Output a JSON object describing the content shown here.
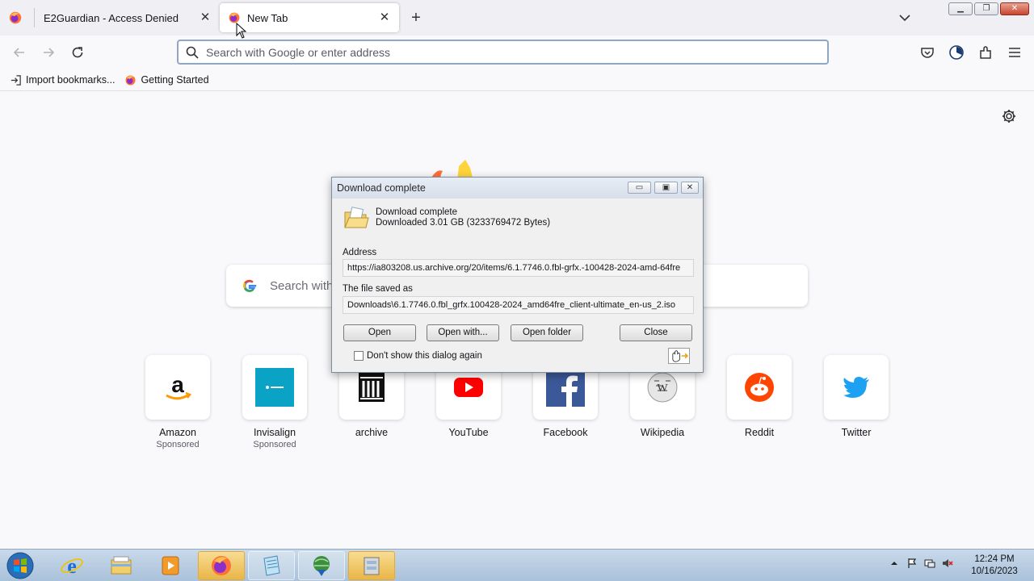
{
  "browser": {
    "tabs": [
      {
        "title": "E2Guardian - Access Denied",
        "active": false
      },
      {
        "title": "New Tab",
        "active": true
      }
    ],
    "tab_close_glyph": "✕",
    "newtab_glyph": "+",
    "window_controls": {
      "minimize": "▁",
      "restore": "❐",
      "close": "✕"
    },
    "urlbar": {
      "placeholder": "Search with Google or enter address",
      "value": ""
    },
    "bookmarks": [
      {
        "label": "Import bookmarks...",
        "icon": "import-icon"
      },
      {
        "label": "Getting Started",
        "icon": "firefox-icon"
      }
    ]
  },
  "newtab": {
    "search_placeholder": "Search with Google or enter address",
    "search_visible_text": "Search with",
    "top_sites": [
      {
        "label": "Amazon",
        "sponsor": "Sponsored",
        "icon": "amazon-icon"
      },
      {
        "label": "Invisalign",
        "sponsor": "Sponsored",
        "icon": "invisalign-icon"
      },
      {
        "label": "archive",
        "sponsor": "",
        "icon": "archive-icon"
      },
      {
        "label": "YouTube",
        "sponsor": "",
        "icon": "youtube-icon"
      },
      {
        "label": "Facebook",
        "sponsor": "",
        "icon": "facebook-icon"
      },
      {
        "label": "Wikipedia",
        "sponsor": "",
        "icon": "wikipedia-icon"
      },
      {
        "label": "Reddit",
        "sponsor": "",
        "icon": "reddit-icon"
      },
      {
        "label": "Twitter",
        "sponsor": "",
        "icon": "twitter-icon"
      }
    ]
  },
  "dialog": {
    "title": "Download complete",
    "heading": "Download complete",
    "size_text": "Downloaded 3.01  GB (3233769472 Bytes)",
    "address_label": "Address",
    "address_value": "https://ia803208.us.archive.org/20/items/6.1.7746.0.fbl-grfx.-100428-2024-amd-64fre",
    "saved_label": "The file saved as",
    "saved_value": "Downloads\\6.1.7746.0.fbl_grfx.100428-2024_amd64fre_client-ultimate_en-us_2.iso",
    "buttons": {
      "open": "Open",
      "open_with": "Open with...",
      "open_folder": "Open folder",
      "close": "Close"
    },
    "checkbox_label": "Don't show this dialog again",
    "controls": {
      "minimize": "▭",
      "restore": "▣",
      "close": "✕"
    }
  },
  "taskbar": {
    "apps": [
      "internet-explorer-icon",
      "file-explorer-icon",
      "media-player-icon",
      "firefox-icon",
      "notepad-icon",
      "network-icon",
      "archive-manager-icon"
    ],
    "time": "12:24 PM",
    "date": "10/16/2023"
  },
  "colors": {
    "accent": "#0061e0",
    "dialog_bg": "#f0f0f0",
    "taskbar_top": "#c8d9ea"
  }
}
